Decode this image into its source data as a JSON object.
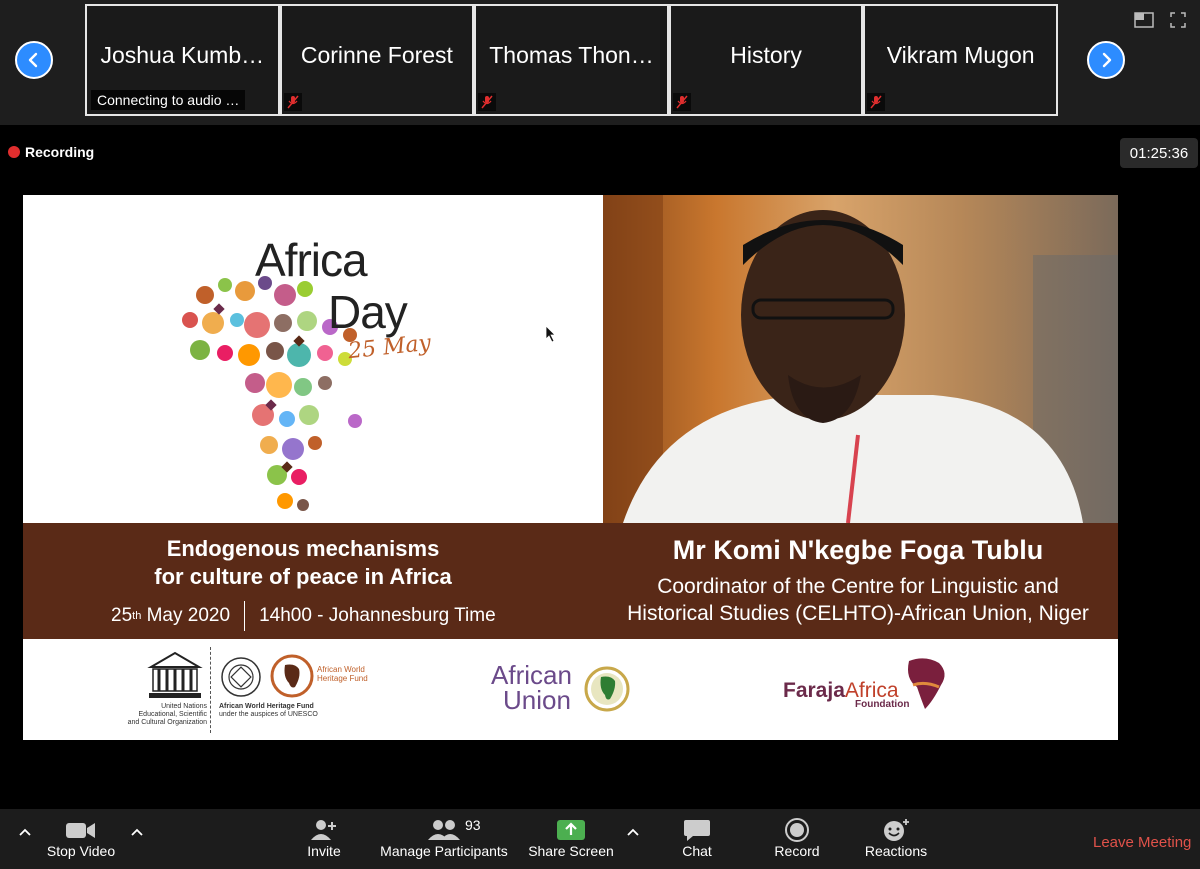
{
  "participants": [
    {
      "name": "Joshua Kumb…",
      "status": "Connecting to audio …",
      "muted": false
    },
    {
      "name": "Corinne Forest",
      "status": "",
      "muted": true
    },
    {
      "name": "Thomas Thon…",
      "status": "",
      "muted": true
    },
    {
      "name": "History",
      "status": "",
      "muted": true
    },
    {
      "name": "Vikram Mugon",
      "status": "",
      "muted": true
    }
  ],
  "recording_label": "Recording",
  "meeting_timer": "01:25:36",
  "slide": {
    "logo_title_1": "Africa",
    "logo_title_2": "Day",
    "logo_date": "25 May",
    "topic_line_1": "Endogenous mechanisms",
    "topic_line_2": "for culture of peace in Africa",
    "date_prefix": "25",
    "date_superscript": "th",
    "date_suffix": " May 2020",
    "time": "14h00 - Johannesburg Time",
    "speaker_name": "Mr Komi N'kegbe Foga Tublu",
    "speaker_role_1": "Coordinator of the Centre for Linguistic and",
    "speaker_role_2": "Historical Studies (CELHTO)-African Union, Niger",
    "unesco_caption": "United Nations Educational, Scientific and Cultural Organization",
    "unesco_wordmark": "UNESCO",
    "awhf_caption_1": "African World Heritage Fund",
    "awhf_caption_2": "under the auspices of UNESCO",
    "awhf_title": "African World Heritage Fund",
    "au_line_1": "African",
    "au_line_2": "Union",
    "faraja_1": "Faraja",
    "faraja_2": "Africa",
    "faraja_3": "Foundation"
  },
  "toolbar": {
    "stop_video": "Stop Video",
    "invite": "Invite",
    "manage_participants": "Manage Participants",
    "participant_count": "93",
    "share_screen": "Share Screen",
    "chat": "Chat",
    "record": "Record",
    "reactions": "Reactions",
    "leave_meeting": "Leave Meeting"
  },
  "colors": {
    "accent_blue": "#2d8cff",
    "share_green": "#4caf50",
    "leave_red": "#e0524a",
    "recording_red": "#e02e2e",
    "slide_band": "#5a2a17"
  }
}
